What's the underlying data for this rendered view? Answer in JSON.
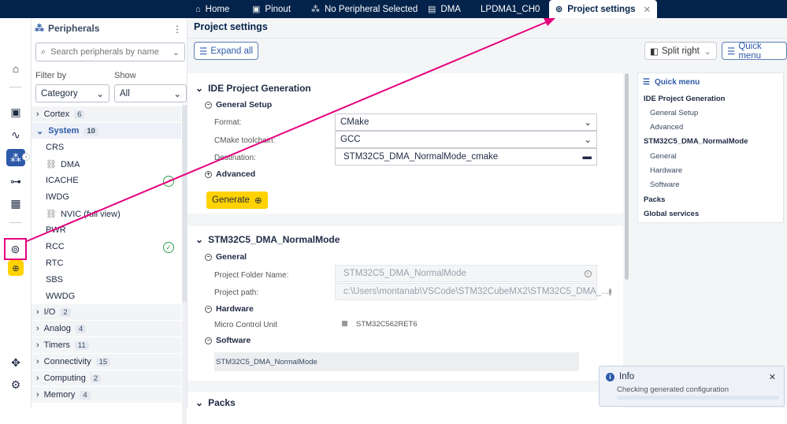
{
  "tabs": [
    {
      "label": "Home",
      "icon": "home-icon"
    },
    {
      "label": "Pinout",
      "icon": "chip-icon"
    },
    {
      "label": "No Peripheral Selected",
      "icon": "peripherals-icon"
    },
    {
      "label": "DMA",
      "icon": "dma-icon"
    },
    {
      "label": "LPDMA1_CH0",
      "icon": ""
    },
    {
      "label": "Project settings",
      "icon": "settings-icon"
    }
  ],
  "sidebar": {
    "title": "Peripherals",
    "search_placeholder": "Search peripherals by name",
    "filter_label": "Filter by",
    "show_label": "Show",
    "filter_value": "Category",
    "show_value": "All",
    "categories": [
      {
        "label": "Cortex",
        "count": "6"
      },
      {
        "label": "System",
        "count": "10"
      },
      {
        "label": "I/O",
        "count": "2"
      },
      {
        "label": "Analog",
        "count": "4"
      },
      {
        "label": "Timers",
        "count": "11"
      },
      {
        "label": "Connectivity",
        "count": "15"
      },
      {
        "label": "Computing",
        "count": "2"
      },
      {
        "label": "Memory",
        "count": "4"
      }
    ],
    "system_items": [
      "CRS",
      "DMA",
      "ICACHE",
      "IWDG",
      "NVIC (full view)",
      "PWR",
      "RCC",
      "RTC",
      "SBS",
      "WWDG"
    ]
  },
  "main": {
    "title": "Project settings",
    "expand_all": "Expand all",
    "split_right": "Split right",
    "quick_menu_btn": "Quick menu",
    "ide": {
      "title": "IDE Project Generation",
      "general_setup": "General Setup",
      "format_label": "Format:",
      "format_value": "CMake",
      "toolchain_label": "CMake toolchain:",
      "toolchain_value": "GCC",
      "destination_label": "Destination:",
      "destination_value": "STM32C5_DMA_NormalMode_cmake",
      "advanced": "Advanced",
      "generate": "Generate"
    },
    "project": {
      "title": "STM32C5_DMA_NormalMode",
      "general": "General",
      "folder_label": "Project Folder Name:",
      "folder_value": "STM32C5_DMA_NormalMode",
      "path_label": "Project path:",
      "path_value": "c:\\Users\\montanab\\VSCode\\STM32CubeMX2\\STM32C5_DMA_...",
      "hardware": "Hardware",
      "mcu_label": "Micro Control Unit",
      "mcu_value": "STM32C562RET6",
      "software": "Software",
      "software_value": "STM32C5_DMA_NormalMode"
    },
    "packs": "Packs"
  },
  "quick_menu": {
    "title": "Quick menu",
    "items": [
      "IDE Project Generation",
      "General Setup",
      "Advanced",
      "STM32C5_DMA_NormalMode",
      "General",
      "Hardware",
      "Software",
      "Packs",
      "Global services"
    ]
  },
  "toast": {
    "title": "Info",
    "message": "Checking generated configuration"
  },
  "colors": {
    "topbar": "#03234b",
    "accent": "#2d5aa8",
    "highlight": "#e6007e",
    "generate": "#ffd200",
    "success": "#2ea44f"
  }
}
